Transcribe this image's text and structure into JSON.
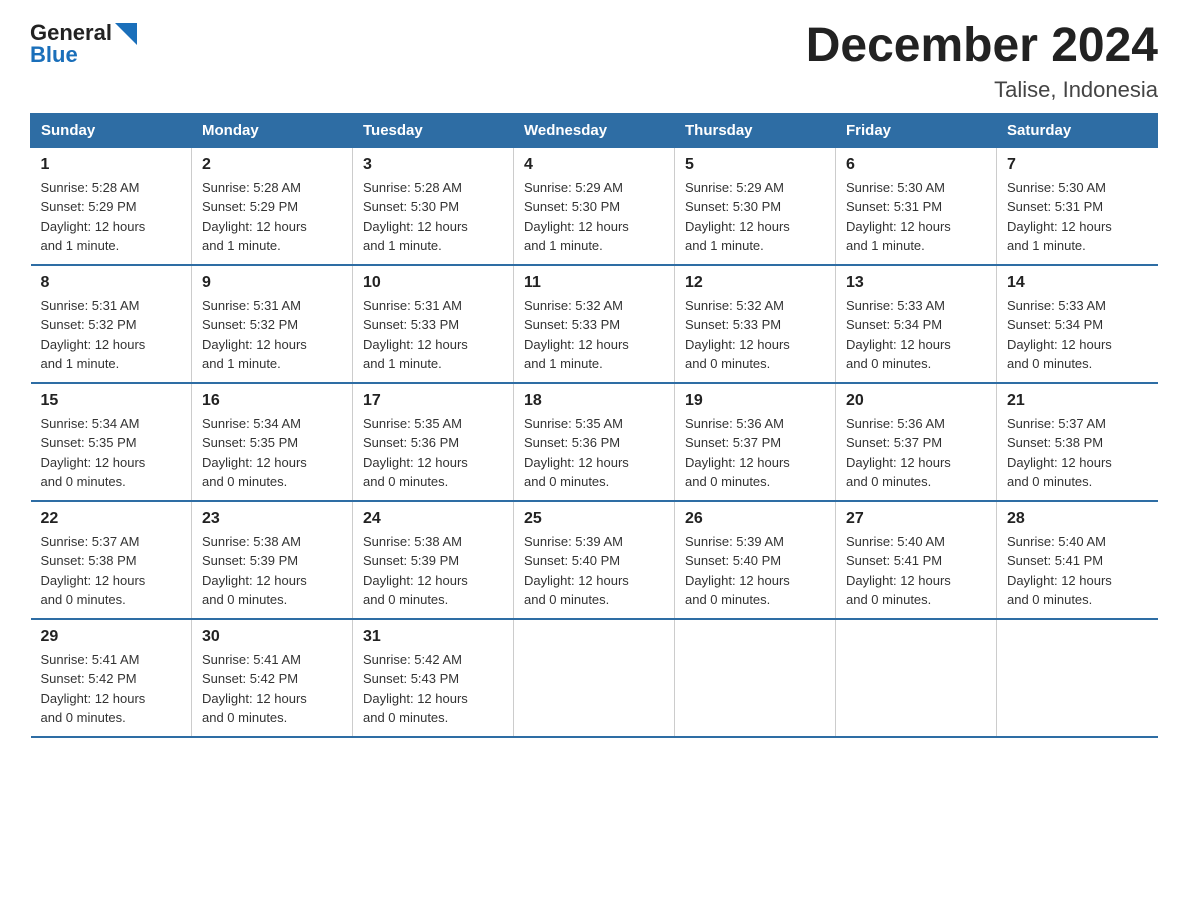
{
  "logo": {
    "general": "General",
    "blue": "Blue"
  },
  "title": "December 2024",
  "location": "Talise, Indonesia",
  "days_of_week": [
    "Sunday",
    "Monday",
    "Tuesday",
    "Wednesday",
    "Thursday",
    "Friday",
    "Saturday"
  ],
  "weeks": [
    [
      {
        "day": "1",
        "sunrise": "5:28 AM",
        "sunset": "5:29 PM",
        "daylight": "12 hours and 1 minute."
      },
      {
        "day": "2",
        "sunrise": "5:28 AM",
        "sunset": "5:29 PM",
        "daylight": "12 hours and 1 minute."
      },
      {
        "day": "3",
        "sunrise": "5:28 AM",
        "sunset": "5:30 PM",
        "daylight": "12 hours and 1 minute."
      },
      {
        "day": "4",
        "sunrise": "5:29 AM",
        "sunset": "5:30 PM",
        "daylight": "12 hours and 1 minute."
      },
      {
        "day": "5",
        "sunrise": "5:29 AM",
        "sunset": "5:30 PM",
        "daylight": "12 hours and 1 minute."
      },
      {
        "day": "6",
        "sunrise": "5:30 AM",
        "sunset": "5:31 PM",
        "daylight": "12 hours and 1 minute."
      },
      {
        "day": "7",
        "sunrise": "5:30 AM",
        "sunset": "5:31 PM",
        "daylight": "12 hours and 1 minute."
      }
    ],
    [
      {
        "day": "8",
        "sunrise": "5:31 AM",
        "sunset": "5:32 PM",
        "daylight": "12 hours and 1 minute."
      },
      {
        "day": "9",
        "sunrise": "5:31 AM",
        "sunset": "5:32 PM",
        "daylight": "12 hours and 1 minute."
      },
      {
        "day": "10",
        "sunrise": "5:31 AM",
        "sunset": "5:33 PM",
        "daylight": "12 hours and 1 minute."
      },
      {
        "day": "11",
        "sunrise": "5:32 AM",
        "sunset": "5:33 PM",
        "daylight": "12 hours and 1 minute."
      },
      {
        "day": "12",
        "sunrise": "5:32 AM",
        "sunset": "5:33 PM",
        "daylight": "12 hours and 0 minutes."
      },
      {
        "day": "13",
        "sunrise": "5:33 AM",
        "sunset": "5:34 PM",
        "daylight": "12 hours and 0 minutes."
      },
      {
        "day": "14",
        "sunrise": "5:33 AM",
        "sunset": "5:34 PM",
        "daylight": "12 hours and 0 minutes."
      }
    ],
    [
      {
        "day": "15",
        "sunrise": "5:34 AM",
        "sunset": "5:35 PM",
        "daylight": "12 hours and 0 minutes."
      },
      {
        "day": "16",
        "sunrise": "5:34 AM",
        "sunset": "5:35 PM",
        "daylight": "12 hours and 0 minutes."
      },
      {
        "day": "17",
        "sunrise": "5:35 AM",
        "sunset": "5:36 PM",
        "daylight": "12 hours and 0 minutes."
      },
      {
        "day": "18",
        "sunrise": "5:35 AM",
        "sunset": "5:36 PM",
        "daylight": "12 hours and 0 minutes."
      },
      {
        "day": "19",
        "sunrise": "5:36 AM",
        "sunset": "5:37 PM",
        "daylight": "12 hours and 0 minutes."
      },
      {
        "day": "20",
        "sunrise": "5:36 AM",
        "sunset": "5:37 PM",
        "daylight": "12 hours and 0 minutes."
      },
      {
        "day": "21",
        "sunrise": "5:37 AM",
        "sunset": "5:38 PM",
        "daylight": "12 hours and 0 minutes."
      }
    ],
    [
      {
        "day": "22",
        "sunrise": "5:37 AM",
        "sunset": "5:38 PM",
        "daylight": "12 hours and 0 minutes."
      },
      {
        "day": "23",
        "sunrise": "5:38 AM",
        "sunset": "5:39 PM",
        "daylight": "12 hours and 0 minutes."
      },
      {
        "day": "24",
        "sunrise": "5:38 AM",
        "sunset": "5:39 PM",
        "daylight": "12 hours and 0 minutes."
      },
      {
        "day": "25",
        "sunrise": "5:39 AM",
        "sunset": "5:40 PM",
        "daylight": "12 hours and 0 minutes."
      },
      {
        "day": "26",
        "sunrise": "5:39 AM",
        "sunset": "5:40 PM",
        "daylight": "12 hours and 0 minutes."
      },
      {
        "day": "27",
        "sunrise": "5:40 AM",
        "sunset": "5:41 PM",
        "daylight": "12 hours and 0 minutes."
      },
      {
        "day": "28",
        "sunrise": "5:40 AM",
        "sunset": "5:41 PM",
        "daylight": "12 hours and 0 minutes."
      }
    ],
    [
      {
        "day": "29",
        "sunrise": "5:41 AM",
        "sunset": "5:42 PM",
        "daylight": "12 hours and 0 minutes."
      },
      {
        "day": "30",
        "sunrise": "5:41 AM",
        "sunset": "5:42 PM",
        "daylight": "12 hours and 0 minutes."
      },
      {
        "day": "31",
        "sunrise": "5:42 AM",
        "sunset": "5:43 PM",
        "daylight": "12 hours and 0 minutes."
      },
      null,
      null,
      null,
      null
    ]
  ],
  "labels": {
    "sunrise": "Sunrise:",
    "sunset": "Sunset:",
    "daylight": "Daylight:"
  }
}
